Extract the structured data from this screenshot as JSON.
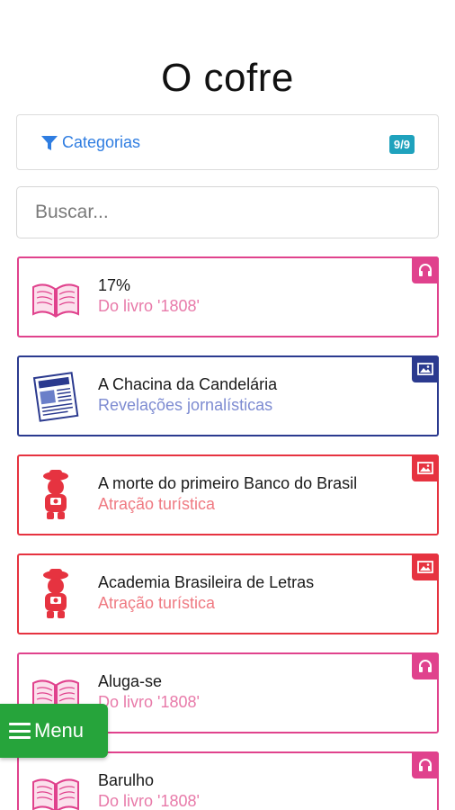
{
  "header": {
    "title": "O cofre"
  },
  "filter": {
    "label": "Categorias",
    "badge": "9/9"
  },
  "search": {
    "placeholder": "Buscar..."
  },
  "colors": {
    "book": "#e0428d",
    "news": "#2b3a8f",
    "tourism": "#e63340",
    "menu": "#26a43b",
    "link": "#2f7de1"
  },
  "items": [
    {
      "name": "17%",
      "subtitle": "Do livro '1808'",
      "icon": "book-icon",
      "type_icon": "headphones-icon"
    },
    {
      "name": "A Chacina da Candelária",
      "subtitle": "Revelações jornalísticas",
      "icon": "newspaper-icon",
      "type_icon": "image-icon"
    },
    {
      "name": "A morte do primeiro Banco do Brasil",
      "subtitle": "Atração turística",
      "icon": "tourist-mascot-icon",
      "type_icon": "image-icon"
    },
    {
      "name": "Academia Brasileira de Letras",
      "subtitle": "Atração turística",
      "icon": "tourist-mascot-icon",
      "type_icon": "image-icon"
    },
    {
      "name": "Aluga-se",
      "subtitle": "Do livro '1808'",
      "icon": "book-icon",
      "type_icon": "headphones-icon"
    },
    {
      "name": "Barulho",
      "subtitle": "Do livro '1808'",
      "icon": "book-icon",
      "type_icon": "headphones-icon"
    }
  ],
  "menu": {
    "label": "Menu"
  }
}
